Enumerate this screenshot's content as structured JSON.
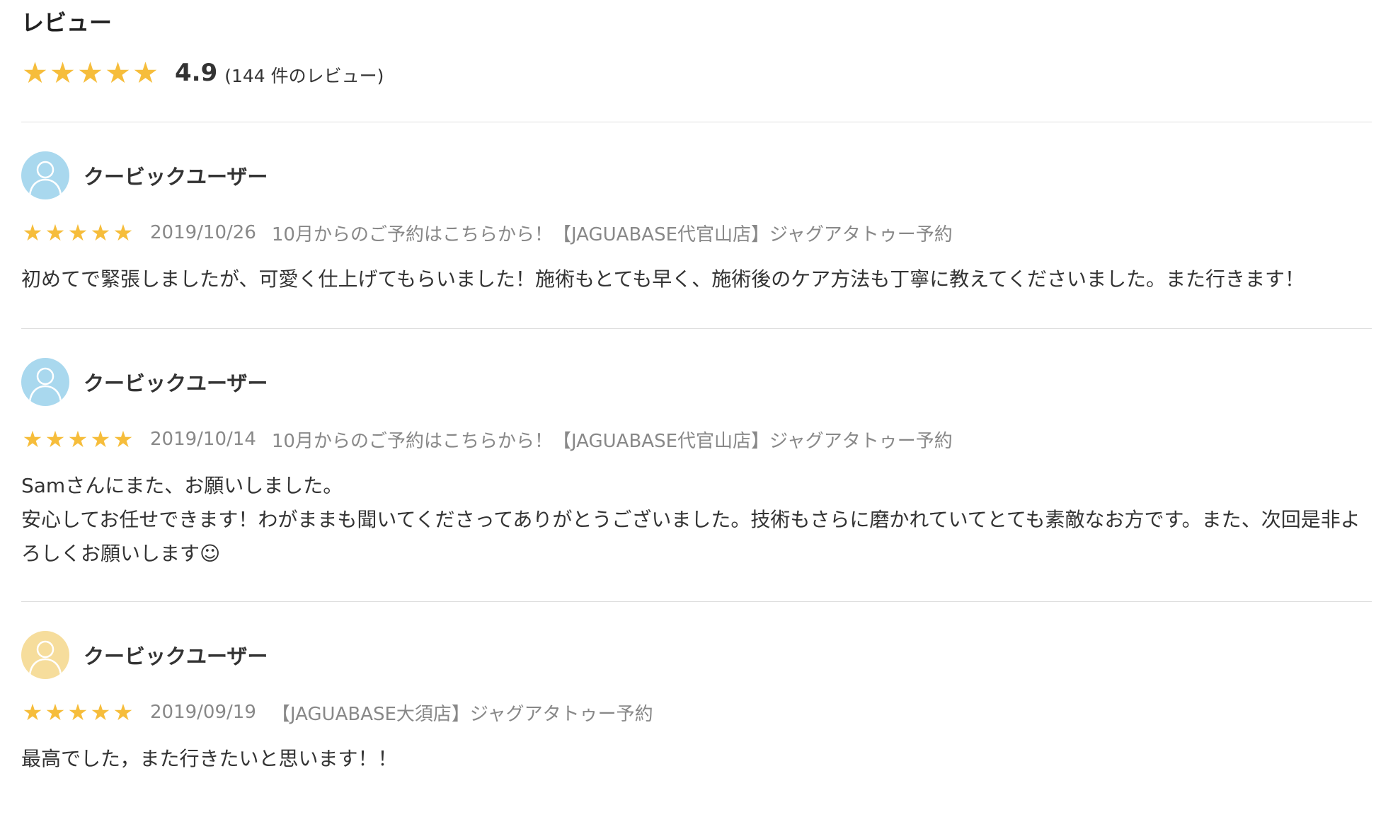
{
  "header": {
    "title": "レビュー"
  },
  "summary": {
    "stars": [
      "★",
      "★",
      "★",
      "★",
      "★"
    ],
    "rating": "4.9",
    "count_text": "(144 件のレビュー)",
    "star_color": "#f6bd3b"
  },
  "reviews": [
    {
      "avatar_color": "#a9d8ee",
      "avatar_icon": "user-icon",
      "user_name": "クービックユーザー",
      "stars": [
        "★",
        "★",
        "★",
        "★",
        "★"
      ],
      "date": "2019/10/26",
      "service": "10月からのご予約はこちらから！【JAGUABASE代官山店】ジャグアタトゥー予約",
      "body": "初めてで緊張しましたが、可愛く仕上げてもらいました！施術もとても早く、施術後のケア方法も丁寧に教えてくださいました。また行きます！"
    },
    {
      "avatar_color": "#a9d8ee",
      "avatar_icon": "user-icon",
      "user_name": "クービックユーザー",
      "stars": [
        "★",
        "★",
        "★",
        "★",
        "★"
      ],
      "date": "2019/10/14",
      "service": "10月からのご予約はこちらから！【JAGUABASE代官山店】ジャグアタトゥー予約",
      "body": "Samさんにまた、お願いしました。\n安心してお任せできます！わがままも聞いてくださってありがとうございました。技術もさらに磨かれていてとても素敵なお方です。また、次回是非よろしくお願いします☺"
    },
    {
      "avatar_color": "#f6dd9c",
      "avatar_icon": "user-icon",
      "user_name": "クービックユーザー",
      "stars": [
        "★",
        "★",
        "★",
        "★",
        "★"
      ],
      "date": "2019/09/19",
      "service": "【JAGUABASE大須店】ジャグアタトゥー予約",
      "body": "最高でした，また行きたいと思います！！"
    }
  ]
}
